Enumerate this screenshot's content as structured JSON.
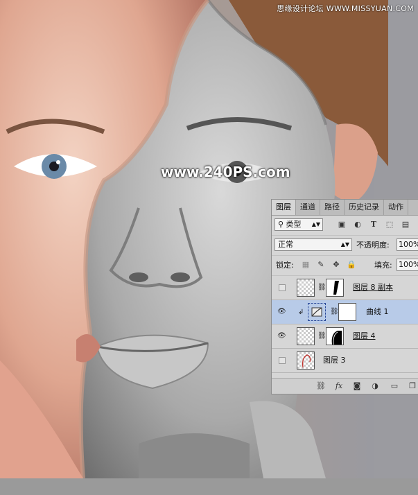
{
  "watermarks": {
    "top_right": "思缘设计论坛 WWW.MISSYUAN.COM",
    "center": "www.240PS.com"
  },
  "layers_panel": {
    "tabs": [
      "图层",
      "通道",
      "路径",
      "历史记录",
      "动作"
    ],
    "filter_label": "类型",
    "blend_mode": "正常",
    "opacity_label": "不透明度:",
    "opacity_value": "100%",
    "lock_label": "锁定:",
    "fill_label": "填充:",
    "fill_value": "100%",
    "layers": [
      {
        "name": "图层 8 副本",
        "visible": false,
        "selected": false
      },
      {
        "name": "曲线 1",
        "visible": true,
        "selected": true
      },
      {
        "name": "图层 4",
        "visible": true,
        "selected": false
      },
      {
        "name": "图层 3",
        "visible": false,
        "selected": false
      }
    ]
  }
}
